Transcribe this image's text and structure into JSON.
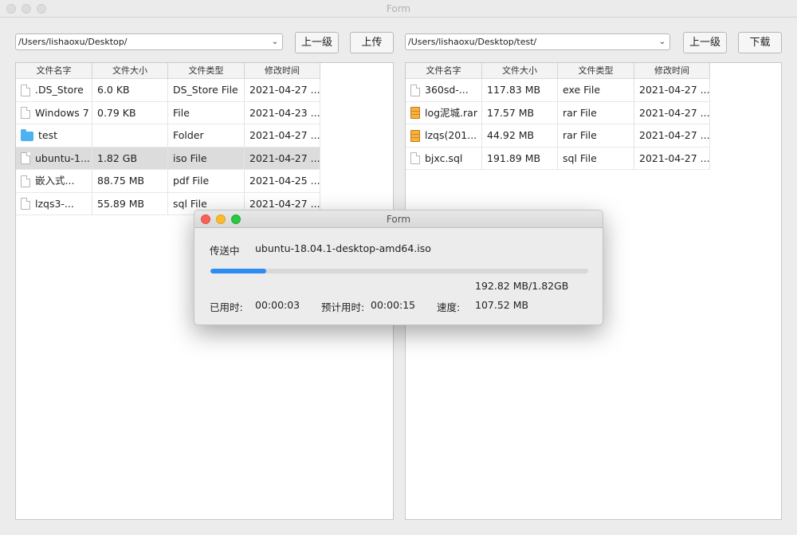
{
  "window": {
    "title": "Form"
  },
  "left": {
    "path": "/Users/lishaoxu/Desktop/",
    "up_label": "上一级",
    "action_label": "上传",
    "columns": [
      "文件名字",
      "文件大小",
      "文件类型",
      "修改时间"
    ],
    "rows": [
      {
        "icon": "file",
        "name": ".DS_Store",
        "size": "6.0  KB",
        "type": "DS_Store File",
        "modified": "2021-04-27 ..."
      },
      {
        "icon": "file",
        "name": "Windows 7",
        "size": "0.79  KB",
        "type": "File",
        "modified": "2021-04-23 ..."
      },
      {
        "icon": "folder",
        "name": "test",
        "size": "",
        "type": "Folder",
        "modified": "2021-04-27 ..."
      },
      {
        "icon": "file",
        "name": "ubuntu-1...",
        "size": "1.82 GB",
        "type": "iso File",
        "modified": "2021-04-27 ...",
        "selected": true
      },
      {
        "icon": "file",
        "name": "嵌入式...",
        "size": "88.75  MB",
        "type": "pdf File",
        "modified": "2021-04-25 ..."
      },
      {
        "icon": "file",
        "name": "lzqs3-...",
        "size": "55.89  MB",
        "type": "sql File",
        "modified": "2021-04-27 ..."
      }
    ]
  },
  "right": {
    "path": "/Users/lishaoxu/Desktop/test/",
    "up_label": "上一级",
    "action_label": "下载",
    "columns": [
      "文件名字",
      "文件大小",
      "文件类型",
      "修改时间"
    ],
    "rows": [
      {
        "icon": "file",
        "name": "360sd-...",
        "size": "117.83  MB",
        "type": "exe File",
        "modified": "2021-04-27 ..."
      },
      {
        "icon": "rar",
        "name": "log泥城.rar",
        "size": "17.57  MB",
        "type": "rar File",
        "modified": "2021-04-27 ..."
      },
      {
        "icon": "rar",
        "name": "lzqs(201...",
        "size": "44.92  MB",
        "type": "rar File",
        "modified": "2021-04-27 ..."
      },
      {
        "icon": "file",
        "name": "bjxc.sql",
        "size": "191.89  MB",
        "type": "sql File",
        "modified": "2021-04-27 ..."
      }
    ]
  },
  "dialog": {
    "title": "Form",
    "status_label": "传送中",
    "filename": "ubuntu-18.04.1-desktop-amd64.iso",
    "progress_fraction": 0.148,
    "progress_text": "192.82 MB/1.82GB",
    "elapsed_label": "已用时:",
    "elapsed_value": "00:00:03",
    "eta_label": "预计用时:",
    "eta_value": "00:00:15",
    "speed_label": "速度:",
    "speed_value": "107.52 MB",
    "accent": "#2c8cf2"
  }
}
